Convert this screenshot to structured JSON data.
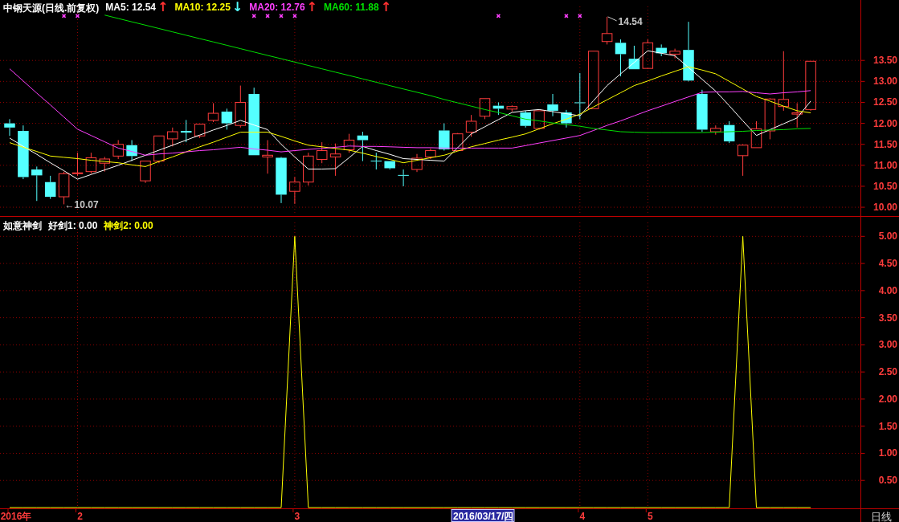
{
  "price_chart": {
    "title": "中钢天源(日线.前复权)",
    "legend": [
      {
        "kind": "value",
        "label": "MA5: 12.54",
        "color": "#ffffff"
      },
      {
        "kind": "arrow",
        "label": "↑",
        "color": "#ff3030"
      },
      {
        "kind": "value",
        "label": "MA10: 12.25",
        "color": "#ffff00"
      },
      {
        "kind": "arrow",
        "label": "↓",
        "color": "#54ffff"
      },
      {
        "kind": "value",
        "label": "MA20: 12.76",
        "color": "#ff40ff"
      },
      {
        "kind": "arrow",
        "label": "↑",
        "color": "#ff3030"
      },
      {
        "kind": "value",
        "label": "MA60: 11.88",
        "color": "#00e000"
      },
      {
        "kind": "arrow",
        "label": "↑",
        "color": "#ff3030"
      }
    ],
    "chart_data": {
      "type": "candlestick",
      "grid": true,
      "ylim": [
        9.81,
        14.94
      ],
      "categories": [
        null,
        null,
        null,
        null,
        null,
        null,
        null,
        null,
        null,
        null,
        null,
        null,
        null,
        null,
        null,
        null,
        null,
        null,
        null,
        null,
        null,
        null,
        null,
        null,
        null,
        null,
        null,
        null,
        null,
        null,
        null,
        null,
        null,
        null,
        null,
        null,
        null,
        null,
        null,
        null,
        null,
        null,
        null,
        null,
        null,
        null,
        null,
        null,
        null,
        null,
        null,
        null,
        null,
        null,
        null,
        null,
        null,
        null,
        null,
        null
      ],
      "yticks": [
        {
          "value": 10,
          "label": "10.00"
        },
        {
          "value": 10.5,
          "label": "10.50"
        },
        {
          "value": 11,
          "label": "11.00"
        },
        {
          "value": 11.5,
          "label": "11.50"
        },
        {
          "value": 12,
          "label": "12.00"
        },
        {
          "value": 12.5,
          "label": "12.50"
        },
        {
          "value": 13,
          "label": "13.00"
        },
        {
          "value": 13.5,
          "label": "13.50"
        }
      ],
      "ohlc": [
        [
          12.0,
          12.1,
          11.7,
          11.9
        ],
        [
          11.82,
          11.95,
          10.67,
          10.72
        ],
        [
          10.9,
          10.97,
          10.15,
          10.76
        ],
        [
          10.6,
          10.75,
          10.2,
          10.25
        ],
        [
          10.25,
          10.85,
          10.07,
          10.8
        ],
        [
          10.8,
          11.3,
          10.75,
          10.82
        ],
        [
          10.85,
          11.3,
          10.8,
          11.18
        ],
        [
          11.05,
          11.2,
          10.85,
          11.15
        ],
        [
          11.22,
          11.6,
          11.15,
          11.5
        ],
        [
          11.48,
          11.6,
          11.1,
          11.22
        ],
        [
          10.63,
          11.1,
          10.58,
          11.1
        ],
        [
          11.1,
          11.7,
          11.05,
          11.7
        ],
        [
          11.63,
          11.9,
          11.45,
          11.8
        ],
        [
          11.82,
          12.08,
          11.55,
          11.78
        ],
        [
          11.7,
          11.98,
          11.65,
          11.98
        ],
        [
          12.07,
          12.48,
          12.03,
          12.24
        ],
        [
          12.28,
          12.35,
          11.85,
          12.0
        ],
        [
          11.95,
          12.9,
          11.9,
          12.5
        ],
        [
          12.7,
          12.85,
          11.24,
          11.24
        ],
        [
          11.2,
          11.6,
          10.8,
          11.24
        ],
        [
          11.18,
          11.2,
          10.1,
          10.3
        ],
        [
          10.38,
          10.72,
          10.08,
          10.6
        ],
        [
          10.6,
          11.3,
          10.52,
          11.22
        ],
        [
          11.14,
          11.55,
          11.05,
          11.35
        ],
        [
          11.2,
          11.52,
          10.75,
          11.27
        ],
        [
          11.37,
          11.75,
          11.3,
          11.6
        ],
        [
          11.71,
          11.8,
          11.1,
          11.6
        ],
        [
          11.11,
          11.3,
          10.9,
          11.1
        ],
        [
          11.1,
          11.1,
          10.9,
          10.93
        ],
        [
          10.77,
          10.9,
          10.5,
          10.76
        ],
        [
          10.9,
          11.27,
          10.84,
          11.17
        ],
        [
          11.2,
          11.4,
          11.15,
          11.35
        ],
        [
          11.83,
          12.0,
          11.35,
          11.38
        ],
        [
          11.35,
          11.77,
          11.35,
          11.75
        ],
        [
          11.79,
          12.2,
          11.68,
          12.05
        ],
        [
          12.17,
          12.59,
          12.1,
          12.59
        ],
        [
          12.42,
          12.5,
          12.2,
          12.35
        ],
        [
          12.34,
          12.43,
          12.28,
          12.4
        ],
        [
          12.26,
          12.3,
          11.9,
          11.94
        ],
        [
          11.88,
          12.3,
          11.85,
          12.3
        ],
        [
          12.45,
          12.7,
          12.17,
          12.3
        ],
        [
          12.26,
          12.32,
          11.9,
          12.0
        ],
        [
          12.5,
          13.2,
          12.1,
          12.49
        ],
        [
          12.35,
          13.72,
          12.35,
          13.72
        ],
        [
          13.95,
          14.54,
          13.88,
          14.14
        ],
        [
          13.92,
          14.0,
          13.12,
          13.65
        ],
        [
          13.54,
          13.85,
          13.29,
          13.29
        ],
        [
          13.31,
          14.0,
          13.3,
          13.92
        ],
        [
          13.8,
          13.88,
          13.6,
          13.67
        ],
        [
          13.65,
          13.78,
          13.55,
          13.72
        ],
        [
          13.75,
          14.42,
          13.0,
          13.02
        ],
        [
          12.7,
          12.8,
          11.8,
          11.85
        ],
        [
          11.8,
          11.95,
          11.73,
          11.88
        ],
        [
          11.96,
          12.05,
          11.53,
          11.57
        ],
        [
          11.23,
          11.5,
          10.75,
          11.48
        ],
        [
          11.42,
          12.05,
          11.42,
          11.87
        ],
        [
          11.82,
          12.6,
          11.62,
          12.58
        ],
        [
          12.4,
          13.72,
          12.3,
          12.57
        ],
        [
          12.22,
          12.48,
          11.9,
          12.25
        ],
        [
          12.33,
          13.48,
          12.3,
          13.48
        ]
      ],
      "series": [
        {
          "type": "line",
          "color": "#ffffff",
          "values": [
            11.65,
            11.45,
            11.26,
            11.06,
            10.87,
            10.67,
            10.78,
            10.89,
            11.0,
            11.12,
            11.24,
            11.36,
            11.48,
            11.6,
            11.72,
            11.84,
            11.95,
            12.07,
            11.96,
            11.85,
            11.5,
            11.2,
            10.91,
            10.91,
            10.92,
            11.18,
            11.45,
            11.35,
            11.26,
            11.16,
            11.14,
            11.12,
            11.1,
            11.42,
            11.75,
            11.92,
            12.09,
            12.26,
            12.3,
            12.33,
            12.28,
            12.23,
            12.18,
            12.54,
            12.9,
            13.18,
            13.45,
            13.73,
            13.67,
            13.61,
            13.33,
            13.05,
            12.77,
            12.42,
            12.06,
            11.71,
            11.85,
            11.99,
            12.13,
            12.53
          ]
        },
        {
          "type": "line",
          "color": "#ffff00",
          "values": [
            11.54,
            11.43,
            11.33,
            11.22,
            11.19,
            11.16,
            11.12,
            11.09,
            11.06,
            11.01,
            10.97,
            11.09,
            11.2,
            11.32,
            11.44,
            11.55,
            11.67,
            11.79,
            11.79,
            11.79,
            11.69,
            11.58,
            11.48,
            11.44,
            11.4,
            11.36,
            11.29,
            11.21,
            11.14,
            11.06,
            11.12,
            11.18,
            11.24,
            11.34,
            11.44,
            11.52,
            11.6,
            11.67,
            11.75,
            11.87,
            11.99,
            12.1,
            12.22,
            12.39,
            12.56,
            12.73,
            12.9,
            13.01,
            13.13,
            13.24,
            13.35,
            13.27,
            13.18,
            13.0,
            12.82,
            12.64,
            12.53,
            12.41,
            12.3,
            12.25
          ]
        },
        {
          "type": "line",
          "color": "#ff40ff",
          "values": [
            13.3,
            13.01,
            12.72,
            12.44,
            12.15,
            11.86,
            11.71,
            11.56,
            11.41,
            11.33,
            11.24,
            11.27,
            11.29,
            11.32,
            11.35,
            11.37,
            11.4,
            11.43,
            11.39,
            11.36,
            11.32,
            11.35,
            11.38,
            11.4,
            11.43,
            11.46,
            11.45,
            11.45,
            11.44,
            11.43,
            11.42,
            11.42,
            11.41,
            11.41,
            11.41,
            11.41,
            11.41,
            11.41,
            11.47,
            11.53,
            11.59,
            11.65,
            11.71,
            11.83,
            11.95,
            12.06,
            12.18,
            12.3,
            12.41,
            12.52,
            12.63,
            12.74,
            12.75,
            12.75,
            12.76,
            12.73,
            12.7,
            12.73,
            12.75,
            12.78
          ]
        },
        {
          "type": "line",
          "color": "#00e000",
          "values": [
            null,
            null,
            null,
            null,
            null,
            null,
            null,
            14.58,
            14.5,
            14.42,
            14.34,
            14.26,
            14.18,
            14.1,
            14.02,
            13.94,
            13.86,
            13.78,
            13.7,
            13.62,
            13.54,
            13.46,
            13.38,
            13.3,
            13.22,
            13.14,
            13.06,
            12.98,
            12.9,
            12.82,
            12.74,
            12.66,
            12.57,
            12.49,
            12.41,
            12.33,
            12.26,
            12.18,
            12.1,
            12.06,
            12.01,
            11.97,
            11.93,
            11.88,
            11.84,
            11.8,
            11.79,
            11.78,
            11.78,
            11.78,
            11.78,
            11.78,
            11.79,
            11.8,
            11.81,
            11.83,
            11.84,
            11.85,
            11.87,
            11.88
          ]
        },
        {
          "type": "scatter",
          "color": "#ff40ff",
          "values": [
            null,
            null,
            null,
            null,
            14.56,
            14.56,
            null,
            null,
            null,
            null,
            null,
            null,
            null,
            null,
            null,
            null,
            null,
            null,
            14.56,
            14.56,
            14.56,
            14.56,
            null,
            null,
            null,
            null,
            null,
            null,
            null,
            null,
            null,
            null,
            null,
            null,
            null,
            null,
            14.56,
            null,
            null,
            null,
            null,
            14.56,
            14.56,
            null,
            null,
            null,
            null,
            null,
            null,
            null,
            null,
            null,
            null,
            null,
            null,
            null,
            null,
            null,
            null,
            null
          ]
        }
      ],
      "annotations": [
        "14.54",
        "←10.07"
      ]
    }
  },
  "indicator_chart": {
    "title": "如意神剑",
    "legend": [
      {
        "kind": "value",
        "label": "好剑1: 0.00",
        "color": "#ffffff"
      },
      {
        "kind": "value",
        "label": "神剑2: 0.00",
        "color": "#ffff00"
      }
    ],
    "chart_data": {
      "type": "line",
      "grid": true,
      "ylim": [
        0,
        5.36
      ],
      "categories": [
        "2016年",
        null,
        null,
        null,
        null,
        "2",
        null,
        null,
        null,
        null,
        null,
        null,
        null,
        null,
        null,
        null,
        null,
        null,
        null,
        null,
        null,
        "3",
        null,
        null,
        null,
        null,
        null,
        null,
        null,
        null,
        null,
        null,
        null,
        null,
        null,
        null,
        null,
        null,
        null,
        null,
        null,
        null,
        "4",
        null,
        null,
        null,
        null,
        "5",
        null,
        null,
        null,
        null,
        null,
        null,
        null,
        null,
        null,
        null,
        null,
        null
      ],
      "yticks": [
        {
          "value": 0.5,
          "label": "0.50"
        },
        {
          "value": 1,
          "label": "1.00"
        },
        {
          "value": 1.5,
          "label": "1.50"
        },
        {
          "value": 2,
          "label": "2.00"
        },
        {
          "value": 2.5,
          "label": "2.50"
        },
        {
          "value": 3,
          "label": "3.00"
        },
        {
          "value": 3.5,
          "label": "3.50"
        },
        {
          "value": 4,
          "label": "4.00"
        },
        {
          "value": 4.5,
          "label": "4.50"
        },
        {
          "value": 5,
          "label": "5.00"
        }
      ],
      "series": [
        {
          "type": "line",
          "color": "#ffff00",
          "values": [
            0,
            0,
            0,
            0,
            0,
            0,
            0,
            0,
            0,
            0,
            0,
            0,
            0,
            0,
            0,
            0,
            0,
            0,
            0,
            0,
            0,
            5,
            0,
            0,
            0,
            0,
            0,
            0,
            0,
            0,
            0,
            0,
            0,
            0,
            0,
            0,
            0,
            0,
            0,
            0,
            0,
            0,
            0,
            0,
            0,
            0,
            0,
            0,
            0,
            0,
            0,
            0,
            0,
            0,
            5,
            0,
            0,
            0,
            0,
            0
          ]
        }
      ]
    },
    "date_cursor": "2016/03/17/四"
  },
  "period": "日线"
}
